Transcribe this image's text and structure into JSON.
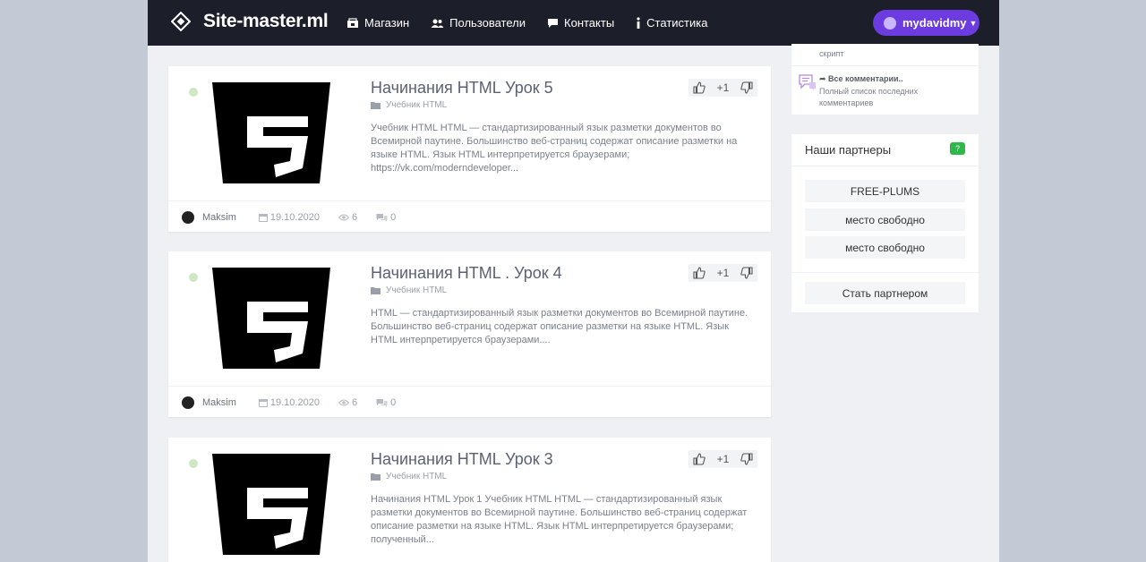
{
  "header": {
    "brand": "Site-master.ml",
    "nav": [
      {
        "label": "Магазин",
        "icon": "shop-icon"
      },
      {
        "label": "Пользователи",
        "icon": "users-icon"
      },
      {
        "label": "Контакты",
        "icon": "chat-icon"
      },
      {
        "label": "Статистика",
        "icon": "info-icon"
      }
    ],
    "user": "mydavidmy"
  },
  "posts": [
    {
      "title": "Начинания HTML Урок 5",
      "category": "Учебник HTML",
      "excerpt": "Учебник HTML HTML — стандартизированный язык разметки документов во Всемирной паутине. Большинство веб-страниц содержат описание разметки на языке HTML. Язык HTML интерпретируется браузерами; https://vk.com/moderndeveloper...",
      "vote": "+1",
      "author": "Maksim",
      "date": "19.10.2020",
      "views": "6",
      "comments": "0"
    },
    {
      "title": "Начинания HTML . Урок 4",
      "category": "Учебник HTML",
      "excerpt": "HTML — стандартизированный язык разметки документов во Всемирной паутине. Большинство веб-страниц содержат описание разметки на языке HTML. Язык HTML интерпретируется браузерами....",
      "vote": "+1",
      "author": "Maksim",
      "date": "19.10.2020",
      "views": "6",
      "comments": "0"
    },
    {
      "title": "Начинания HTML Урок 3",
      "category": "Учебник HTML",
      "excerpt": "Начинания HTML Урок 1 Учебник HTML HTML — стандартизированный язык разметки документов во Всемирной паутине. Большинство веб-страниц содержат описание разметки на языке HTML. Язык HTML интерпретируется браузерами; полученный...",
      "vote": "+1"
    }
  ],
  "sidebar": {
    "top_line": "скрипт",
    "all_comments_title": "Все комментарии..",
    "all_comments_desc": "Полный список последних комментариев",
    "partners": {
      "heading": "Наши партнеры",
      "help": "?",
      "slots": [
        "FREE-PLUMS",
        "место свободно",
        "место свободно"
      ],
      "become": "Стать партнером"
    }
  },
  "colors": {
    "topbar": "#1c1e2a",
    "accent": "#6c3ce0",
    "online": "#cfe8c3",
    "help_badge": "#2eb84b"
  }
}
